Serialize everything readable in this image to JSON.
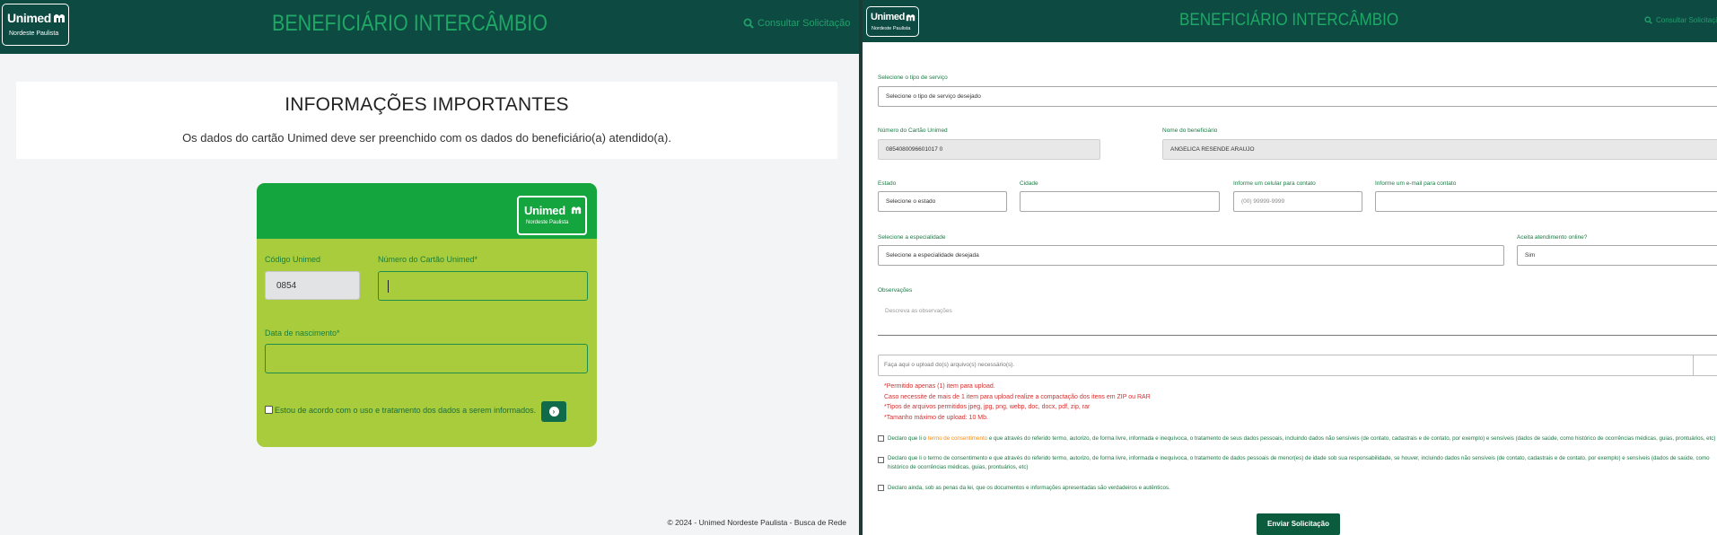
{
  "brand": {
    "logo_text": "Unimed",
    "logo_sub": "Nordeste Paulista",
    "header_title": "BENEFICIÁRIO INTERCÂMBIO",
    "consult_link": "Consultar Solicitação",
    "header_bg": "#0c4a42",
    "title_color": "#1fa766"
  },
  "login_page": {
    "info_title": "INFORMAÇÕES IMPORTANTES",
    "info_text": "Os dados do cartão Unimed deve ser preenchido com os dados do beneficiário(a) atendido(a).",
    "code_label": "Código Unimed",
    "code_value": "0854",
    "card_label": "Número do Cartão Unimed*",
    "card_value": "",
    "birth_label": "Data de nascimento*",
    "birth_value": "",
    "consent_label": "Estou de acordo com o uso e tratamento dos dados a serem informados.",
    "footer": "© 2024 - Unimed Nordeste Paulista - Busca de Rede"
  },
  "request_form": {
    "service_label": "Selecione o tipo de serviço",
    "service_value": "Selecione o tipo de serviço desejado",
    "card_label": "Número do Cartão Unimed",
    "card_value": "0854080096601017 0",
    "beneficiary_label": "Nome do beneficiário",
    "beneficiary_value": "ANGELICA RESENDE ARAUJO",
    "state_label": "Estado",
    "state_value": "Selecione o estado",
    "city_label": "Cidade",
    "city_value": "",
    "phone_label": "Informe um celular para contato",
    "phone_placeholder": "(00) 99999-9999",
    "email_label": "Informe um e-mail para contato",
    "email_value": "",
    "specialty_label": "Selecione a especialidade",
    "specialty_value": "Selecione a especialidade desejada",
    "online_label": "Aceita atendimento online?",
    "online_value": "Sim",
    "notes_label": "Observações",
    "notes_placeholder": "Descreva as observações",
    "upload_placeholder": "Faça aqui o upload do(s) arquivo(s) necessário(s).",
    "rules": [
      "*Permitido apenas (1) item para upload.",
      "Caso necessite de mais de 1 item para upload realize a compactação dos itens em ZIP ou RAR",
      "*Tipos de arquivos permitidos jpeg, jpg, png, webp, doc, docx, pdf, zip, rar",
      "*Tamanho máximo de upload: 10 Mb."
    ],
    "declaration_1a": "Declaro que li o ",
    "declaration_1_link": "termo de consentimento",
    "declaration_1b": " e que através do referido termo, autorizo, de forma livre, informada e inequívoca, o tratamento de seus dados pessoais, incluindo dados não sensíveis (de contato, cadastrais e de contato, por exemplo) e sensíveis (dados de saúde, como histórico de ocorrências médicas, guias, prontuários, etc)",
    "declaration_2": "Declaro que li o termo de consentimento e que através do referido termo, autorizo, de forma livre, informada e inequívoca, o tratamento de dados pessoais de menor(es) de idade sob sua responsabilidade, se houver, incluindo dados não sensíveis (de contato, cadastrais e de contato, por exemplo) e sensíveis (dados de saúde, como histórico de ocorrências médicas, guias, prontuários, etc)",
    "declaration_3": "Declaro ainda, sob as penas da lei, que os documentos e informações apresentadas são verdadeiros e autênticos.",
    "submit_label": "Enviar Solicitação"
  }
}
